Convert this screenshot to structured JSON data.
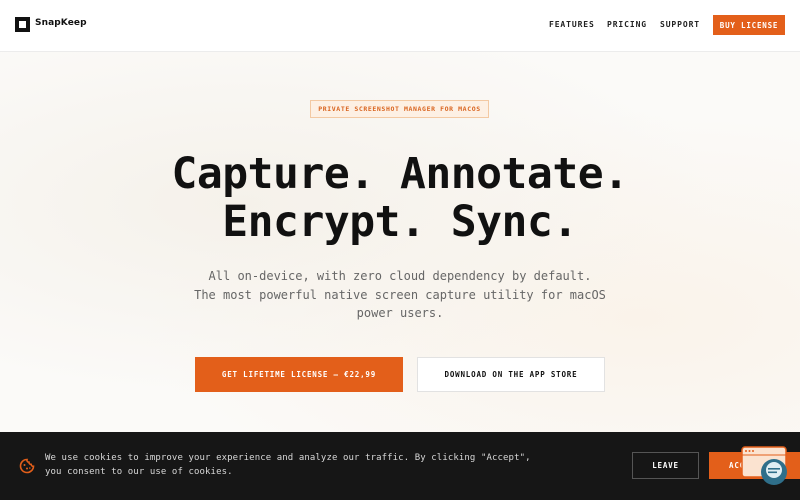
{
  "header": {
    "brand": "SnapKeep",
    "nav": {
      "features": "FEATURES",
      "pricing": "PRICING",
      "support": "SUPPORT"
    },
    "buy_label": "BUY LICENSE"
  },
  "hero": {
    "badge": "PRIVATE SCREENSHOT MANAGER FOR MACOS",
    "headline_line1": "Capture. Annotate.",
    "headline_line2": "Encrypt. Sync.",
    "subtitle_line1": "All on-device, with zero cloud dependency by default.",
    "subtitle_line2": "The most powerful native screen capture utility for macOS",
    "subtitle_line3": "power users.",
    "cta_primary": "GET LIFETIME LICENSE — €22,99",
    "cta_secondary": "DOWNLOAD ON THE APP STORE"
  },
  "cookie_banner": {
    "text_line1": "We use cookies to improve your experience and analyze our traffic. By clicking \"Accept\",",
    "text_line2": "you consent to our use of cookies.",
    "leave_label": "LEAVE",
    "accept_label": "ACCEPT",
    "icon": "cookie-icon"
  },
  "colors": {
    "accent": "#e35f1a",
    "badge_bg": "#fdf0e4",
    "cookie_bg": "#161616",
    "chat_widget": "#2f6f8a"
  },
  "icons": {
    "logo": "square-logo-icon",
    "chat": "chat-widget-icon"
  }
}
